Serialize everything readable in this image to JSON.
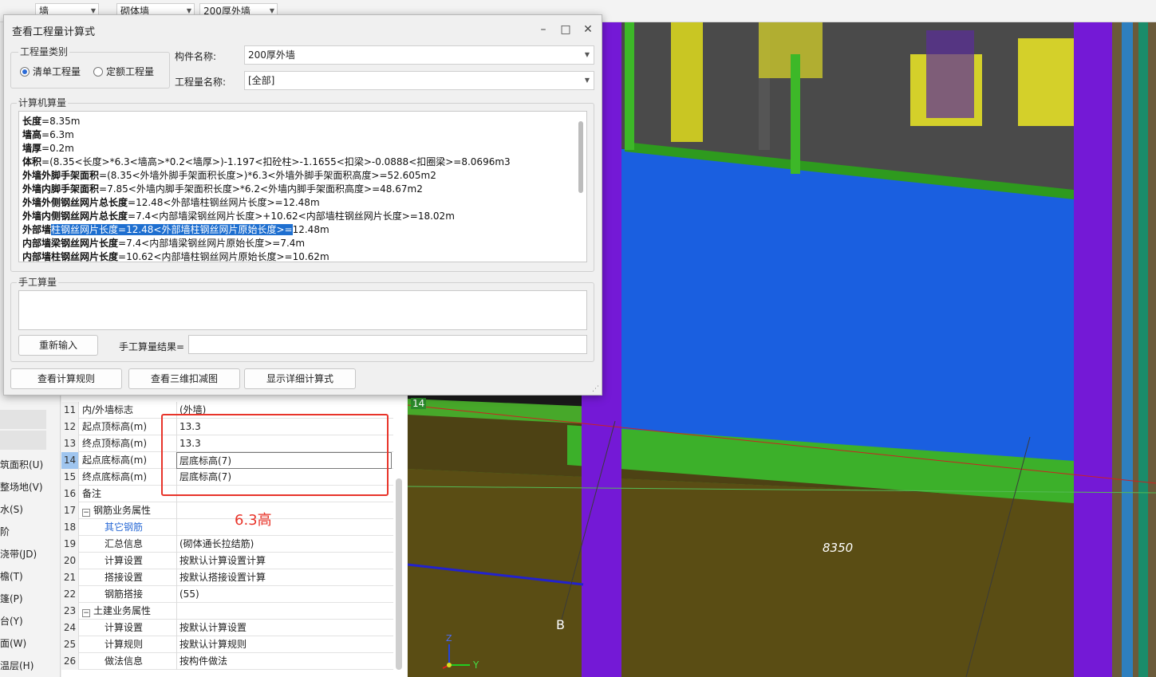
{
  "toolbar": {
    "combo1": "墙",
    "combo2": "砌体墙",
    "combo3": "200厚外墙"
  },
  "left_nav": {
    "items": [
      "筑面积(U)",
      "整场地(V)",
      "水(S)",
      "阶",
      "浇带(JD)",
      "檐(T)",
      "篷(P)",
      "台(Y)",
      "面(W)",
      "温层(H)"
    ]
  },
  "property_rows": [
    {
      "num": "11",
      "name": "内/外墙标志",
      "value": "(外墙)"
    },
    {
      "num": "12",
      "name": "起点顶标高(m)",
      "value": "13.3"
    },
    {
      "num": "13",
      "name": "终点顶标高(m)",
      "value": "13.3"
    },
    {
      "num": "14",
      "name": "起点底标高(m)",
      "value": "层底标高(7)"
    },
    {
      "num": "15",
      "name": "终点底标高(m)",
      "value": "层底标高(7)"
    },
    {
      "num": "16",
      "name": "备注",
      "value": ""
    },
    {
      "num": "17",
      "name": "钢筋业务属性",
      "value": ""
    },
    {
      "num": "18",
      "name": "其它钢筋",
      "value": ""
    },
    {
      "num": "19",
      "name": "汇总信息",
      "value": "(砌体通长拉结筋)"
    },
    {
      "num": "20",
      "name": "计算设置",
      "value": "按默认计算设置计算"
    },
    {
      "num": "21",
      "name": "搭接设置",
      "value": "按默认搭接设置计算"
    },
    {
      "num": "22",
      "name": "钢筋搭接",
      "value": "(55)"
    },
    {
      "num": "23",
      "name": "土建业务属性",
      "value": ""
    },
    {
      "num": "24",
      "name": "计算设置",
      "value": "按默认计算设置"
    },
    {
      "num": "25",
      "name": "计算规则",
      "value": "按默认计算规则"
    },
    {
      "num": "26",
      "name": "做法信息",
      "value": "按构件做法"
    }
  ],
  "annotation": "6.3高",
  "viewport": {
    "dimension_label": "8350",
    "axis_label": "B",
    "grid_marker": "14",
    "axis_z": "Z",
    "axis_y": "Y"
  },
  "dialog": {
    "title": "查看工程量计算式",
    "qty_type_label": "工程量类别",
    "radio_list": "清单工程量",
    "radio_quota": "定额工程量",
    "component_name_label": "构件名称:",
    "component_name_value": "200厚外墙",
    "qty_name_label": "工程量名称:",
    "qty_name_value": "[全部]",
    "computer_calc_label": "计算机算量",
    "calc_lines": [
      {
        "bold": "长度",
        "rest": "=8.35m"
      },
      {
        "bold": "墙高",
        "rest": "=6.3m"
      },
      {
        "bold": "墙厚",
        "rest": "=0.2m"
      },
      {
        "bold": "体积",
        "rest": "=(8.35<长度>*6.3<墙高>*0.2<墙厚>)-1.197<扣砼柱>-1.1655<扣梁>-0.0888<扣圈梁>=8.0696m3"
      },
      {
        "bold": "外墙外脚手架面积",
        "rest": "=(8.35<外墙外脚手架面积长度>)*6.3<外墙外脚手架面积高度>=52.605m2"
      },
      {
        "bold": "外墙内脚手架面积",
        "rest": "=7.85<外墙内脚手架面积长度>*6.2<外墙内脚手架面积高度>=48.67m2"
      },
      {
        "bold": "外墙外侧钢丝网片总长度",
        "rest": "=12.48<外部墙柱钢丝网片长度>=12.48m"
      },
      {
        "bold": "外墙内侧钢丝网片总长度",
        "rest": "=7.4<内部墙梁钢丝网片长度>+10.62<内部墙柱钢丝网片长度>=18.02m"
      },
      {
        "bold": "外部墙",
        "selected": "柱钢丝网片长度=12.48<外部墙柱钢丝网片原始长度>=",
        "rest": "12.48m"
      },
      {
        "bold": "内部墙梁钢丝网片长度",
        "rest": "=7.4<内部墙梁钢丝网片原始长度>=7.4m"
      },
      {
        "bold": "内部墙柱钢丝网片长度",
        "rest": "=10.62<内部墙柱钢丝网片原始长度>=10.62m"
      }
    ],
    "manual_label": "手工算量",
    "reinput_button": "重新输入",
    "manual_result_label": "手工算量结果=",
    "rule_button": "查看计算规则",
    "view3d_button": "查看三维扣减图",
    "detail_button": "显示详细计算式"
  }
}
